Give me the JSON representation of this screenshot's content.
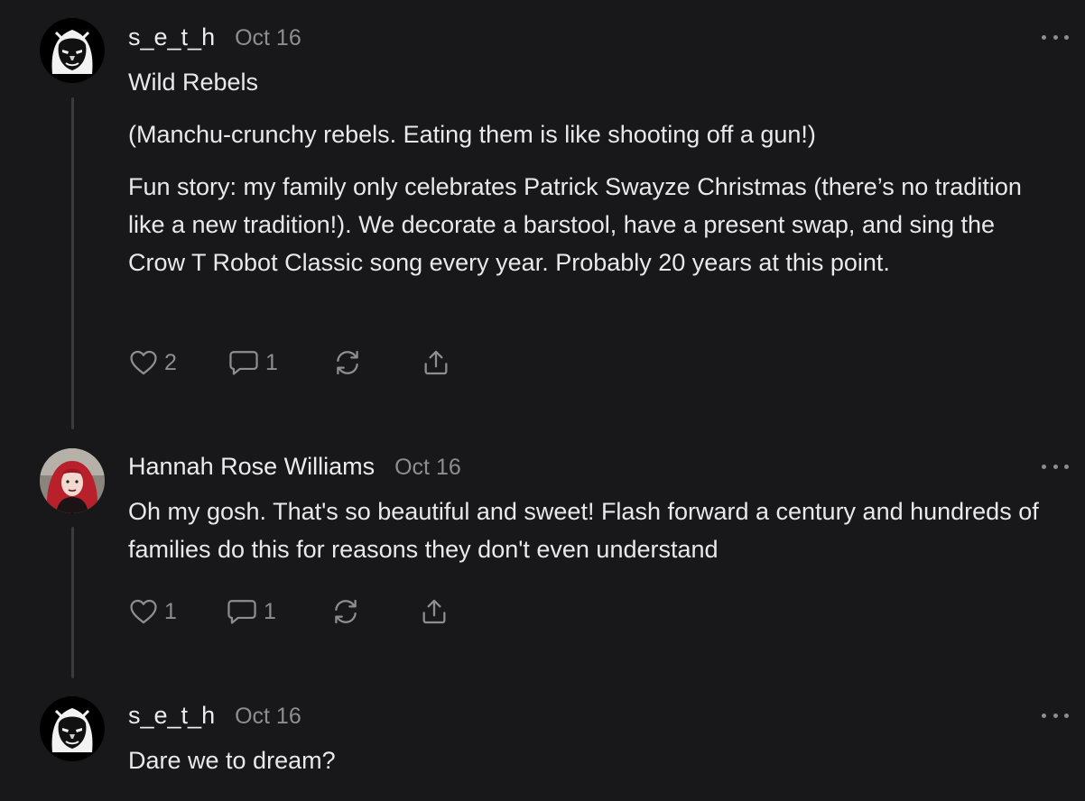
{
  "comments": [
    {
      "author": "s_e_t_h",
      "date": "Oct 16",
      "avatar_icon": "hooded-face-avatar-icon",
      "paragraphs": [
        "Wild Rebels",
        "(Manchu-crunchy rebels. Eating them is like shooting off a gun!)",
        "Fun story: my family only celebrates Patrick Swayze Christmas (there’s no tradition like a new tradition!). We decorate a barstool, have a present swap, and sing the Crow T Robot Classic song every year. Probably 20 years at this point."
      ],
      "likes": "2",
      "replies": "1"
    },
    {
      "author": "Hannah Rose Williams",
      "date": "Oct 16",
      "avatar_icon": "profile-photo-red-hair",
      "paragraphs": [
        "Oh my gosh. That's so beautiful and sweet! Flash forward a century and hundreds of families do this for reasons they don't even understand"
      ],
      "likes": "1",
      "replies": "1"
    },
    {
      "author": "s_e_t_h",
      "date": "Oct 16",
      "avatar_icon": "hooded-face-avatar-icon",
      "paragraphs": [
        "Dare we to dream?"
      ]
    }
  ],
  "colors": {
    "background": "#18181a",
    "text": "#e9e9ea",
    "muted": "#8d8d92",
    "thread_line": "#3a3a3c"
  }
}
